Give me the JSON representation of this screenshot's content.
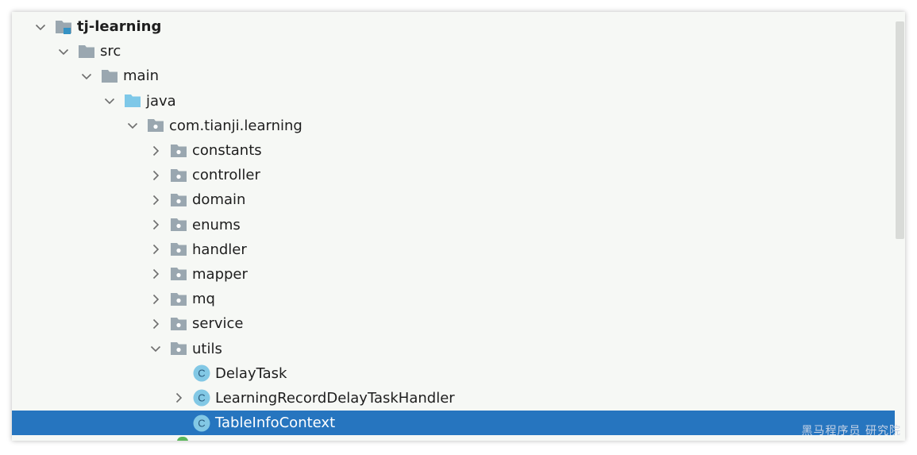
{
  "tree": {
    "rows": [
      {
        "label": "tj-learning",
        "level": 0,
        "chevron": "down",
        "icon": "module",
        "bold": true,
        "selected": false,
        "icon_name": "module-folder-icon"
      },
      {
        "label": "src",
        "level": 1,
        "chevron": "down",
        "icon": "folder",
        "bold": false,
        "selected": false,
        "icon_name": "folder-icon"
      },
      {
        "label": "main",
        "level": 2,
        "chevron": "down",
        "icon": "folder",
        "bold": false,
        "selected": false,
        "icon_name": "folder-icon"
      },
      {
        "label": "java",
        "level": 3,
        "chevron": "down",
        "icon": "source",
        "bold": false,
        "selected": false,
        "icon_name": "source-root-icon"
      },
      {
        "label": "com.tianji.learning",
        "level": 4,
        "chevron": "down",
        "icon": "package",
        "bold": false,
        "selected": false,
        "icon_name": "package-icon"
      },
      {
        "label": "constants",
        "level": 5,
        "chevron": "right",
        "icon": "package",
        "bold": false,
        "selected": false,
        "icon_name": "package-icon"
      },
      {
        "label": "controller",
        "level": 5,
        "chevron": "right",
        "icon": "package",
        "bold": false,
        "selected": false,
        "icon_name": "package-icon"
      },
      {
        "label": "domain",
        "level": 5,
        "chevron": "right",
        "icon": "package",
        "bold": false,
        "selected": false,
        "icon_name": "package-icon"
      },
      {
        "label": "enums",
        "level": 5,
        "chevron": "right",
        "icon": "package",
        "bold": false,
        "selected": false,
        "icon_name": "package-icon"
      },
      {
        "label": "handler",
        "level": 5,
        "chevron": "right",
        "icon": "package",
        "bold": false,
        "selected": false,
        "icon_name": "package-icon"
      },
      {
        "label": "mapper",
        "level": 5,
        "chevron": "right",
        "icon": "package",
        "bold": false,
        "selected": false,
        "icon_name": "package-icon"
      },
      {
        "label": "mq",
        "level": 5,
        "chevron": "right",
        "icon": "package",
        "bold": false,
        "selected": false,
        "icon_name": "package-icon"
      },
      {
        "label": "service",
        "level": 5,
        "chevron": "right",
        "icon": "package",
        "bold": false,
        "selected": false,
        "icon_name": "package-icon"
      },
      {
        "label": "utils",
        "level": 5,
        "chevron": "down",
        "icon": "package",
        "bold": false,
        "selected": false,
        "icon_name": "package-icon"
      },
      {
        "label": "DelayTask",
        "level": 6,
        "chevron": "none",
        "icon": "class",
        "bold": false,
        "selected": false,
        "icon_name": "java-class-icon"
      },
      {
        "label": "LearningRecordDelayTaskHandler",
        "level": 6,
        "chevron": "right",
        "icon": "class",
        "bold": false,
        "selected": false,
        "icon_name": "java-class-icon"
      },
      {
        "label": "TableInfoContext",
        "level": 6,
        "chevron": "none",
        "icon": "class",
        "bold": false,
        "selected": true,
        "icon_name": "java-class-icon"
      }
    ]
  },
  "class_icon_letter": "C",
  "watermark": "黑马程序员 研究院",
  "colors": {
    "panel_bg": "#f6f8f5",
    "selection": "#2675bf",
    "folder_gray": "#9aa7b0",
    "source_blue": "#7ec8e8",
    "module_blue": "#3592c4",
    "class_icon_bg": "#82c8e5",
    "class_icon_fg": "#28587a",
    "chevron": "#6e6e6e"
  }
}
